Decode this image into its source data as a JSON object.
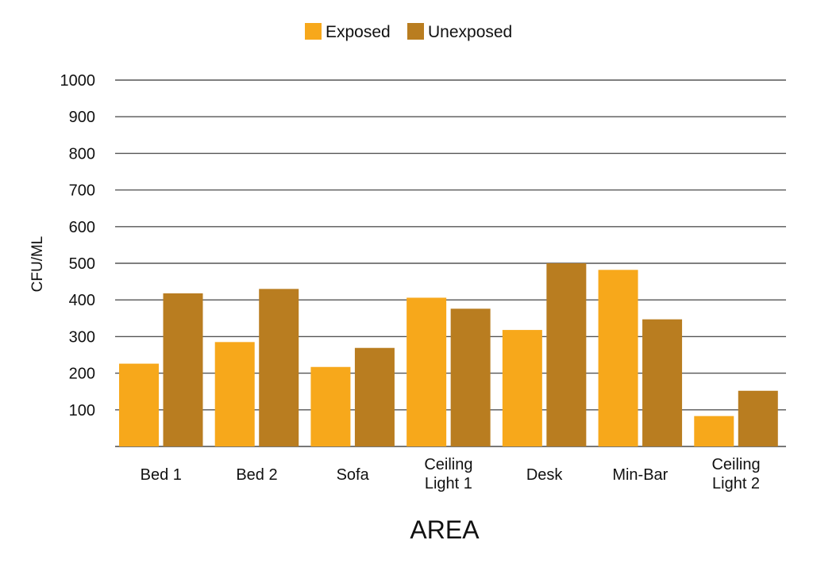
{
  "chart_data": {
    "type": "bar",
    "title": "",
    "xlabel": "AREA",
    "ylabel": "CFU/ML",
    "ylim": [
      0,
      1000
    ],
    "yticks": [
      100,
      200,
      300,
      400,
      500,
      600,
      700,
      800,
      900,
      1000
    ],
    "grid": true,
    "legend_position": "top-center",
    "categories": [
      [
        "Bed 1"
      ],
      [
        "Bed 2"
      ],
      [
        "Sofa"
      ],
      [
        "Ceiling",
        "Light 1"
      ],
      [
        "Desk"
      ],
      [
        "Min-Bar"
      ],
      [
        "Ceiling",
        "Light 2"
      ]
    ],
    "series": [
      {
        "name": "Exposed",
        "color": "#F7A81B",
        "values": [
          226,
          285,
          217,
          406,
          318,
          482,
          83
        ]
      },
      {
        "name": "Unexposed",
        "color": "#B97D20",
        "values": [
          418,
          430,
          269,
          376,
          500,
          347,
          152
        ]
      }
    ]
  }
}
